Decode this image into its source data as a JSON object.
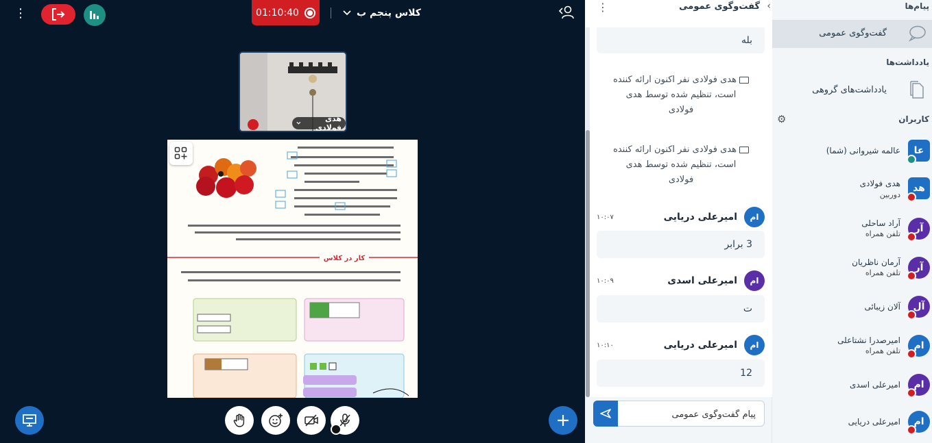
{
  "colors": {
    "leave_red": "#e0242f",
    "record_red": "#d01e22",
    "brand_blue": "#1f6fc5",
    "teal": "#1d8f83",
    "purple": "#5a2ea6",
    "dark_bg": "#06172a"
  },
  "topbar": {
    "options_icon": "vertical-dots-icon",
    "leave_icon": "leave-icon",
    "stats_icon": "bar-chart-icon",
    "recording_time": "01:10:40",
    "meeting_title": "کلاس پنجم ب",
    "user_list_icon": "user-list-icon"
  },
  "webcam": {
    "name": "هدی فولادی"
  },
  "controls": {
    "screen_share_icon": "presentation-icon",
    "raise_hand_icon": "hand-icon",
    "reactions_icon": "smiley-plus-icon",
    "camera_icon": "camera-off-icon",
    "mic_icon": "mic-off-icon",
    "actions_icon": "plus-icon"
  },
  "chat": {
    "title": "گفت‌وگوی عمومی",
    "messages": [
      {
        "text": "بله"
      },
      {
        "text": "هدی فولادی نفر اکنون ارائه کننده است، تنظیم شده توسط هدی فولادی"
      },
      {
        "text": "هدی فولادی نفر اکنون ارائه کننده است، تنظیم شده توسط هدی فولادی"
      },
      {
        "initials": "ام",
        "name": "امیرعلی دریایی",
        "time": "۱۰:۰۷",
        "text": "3 برابر"
      },
      {
        "initials": "ام",
        "name": "امیرعلی اسدی",
        "time": "۱۰:۰۹",
        "text": "ت"
      },
      {
        "initials": "ام",
        "name": "امیرعلی دریایی",
        "time": "۱۰:۱۰",
        "text": "12"
      }
    ],
    "input_placeholder": "پیام گفت‌وگوی عمومی"
  },
  "sidebar": {
    "messages_title": "پیام‌ها",
    "public_chat_label": "گفت‌وگوی عمومی",
    "notes_title": "یادداشت‌ها",
    "shared_notes_label": "یادداشت‌های گروهی",
    "users_title": "کاربران",
    "users": [
      {
        "initials": "عا",
        "name": "عالمه شیروانی (شما)",
        "sub": ""
      },
      {
        "initials": "هد",
        "name": "هدی فولادی",
        "sub": "دوربین"
      },
      {
        "initials": "آر",
        "name": "آراد ساحلی",
        "sub": "تلفن همراه"
      },
      {
        "initials": "آر",
        "name": "آرمان ناظریان",
        "sub": "تلفن همراه"
      },
      {
        "initials": "آل",
        "name": "آلان زیبائی",
        "sub": ""
      },
      {
        "initials": "ام",
        "name": "امیرصدرا نشتاعلی",
        "sub": "تلفن همراه"
      },
      {
        "initials": "ام",
        "name": "امیرعلی اسدی",
        "sub": ""
      },
      {
        "initials": "ام",
        "name": "امیرعلی دریایی",
        "sub": ""
      }
    ]
  },
  "slide": {
    "section_title": "کار در کلاس",
    "button_icon": "multi-user-whiteboard-icon"
  }
}
